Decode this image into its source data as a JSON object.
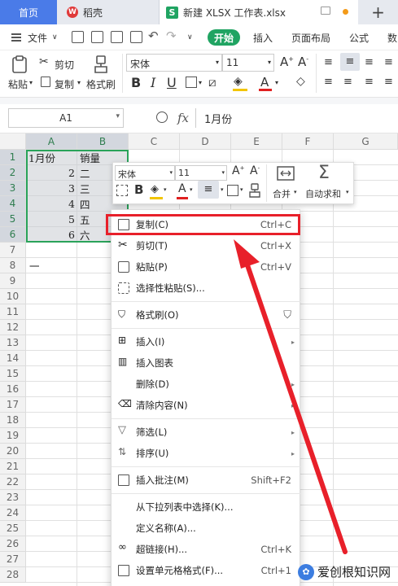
{
  "tabs": {
    "home": "首页",
    "wps": "稻壳",
    "file": "新建 XLSX 工作表.xlsx",
    "plus": "+"
  },
  "menu": {
    "file": "文件",
    "start": "开始",
    "insert": "插入",
    "page_layout": "页面布局",
    "formula": "公式",
    "data": "数"
  },
  "ribbon": {
    "paste": "粘贴",
    "cut": "剪切",
    "copy": "复制",
    "format_painter": "格式刷",
    "font_name": "宋体",
    "font_size": "11"
  },
  "formula_bar": {
    "name_box": "A1",
    "fx": "fx",
    "value": "1月份"
  },
  "grid": {
    "columns": [
      "A",
      "B",
      "C",
      "D",
      "E",
      "F",
      "G"
    ],
    "rows": [
      "1",
      "2",
      "3",
      "4",
      "5",
      "6",
      "7",
      "8",
      "9",
      "10",
      "11",
      "12",
      "13",
      "14",
      "15",
      "16",
      "17",
      "18",
      "19",
      "20",
      "21",
      "22",
      "23",
      "24",
      "25",
      "26",
      "27",
      "28"
    ],
    "cells": {
      "a1": "1月份",
      "b1": "销量",
      "a2": "2",
      "b2": "二",
      "a3": "3",
      "b3": "三",
      "a4": "4",
      "b4": "四",
      "a5": "5",
      "b5": "五",
      "a6": "6",
      "b6": "六",
      "a8": "一"
    }
  },
  "minibar": {
    "font_name": "宋体",
    "font_size": "11",
    "merge": "合并",
    "autosum": "自动求和"
  },
  "context_menu": {
    "copy": "复制(C)",
    "copy_sc": "Ctrl+C",
    "cut": "剪切(T)",
    "cut_sc": "Ctrl+X",
    "paste": "粘贴(P)",
    "paste_sc": "Ctrl+V",
    "paste_special": "选择性粘贴(S)...",
    "format_painter": "格式刷(O)",
    "insert": "插入(I)",
    "insert_chart": "插入图表",
    "delete": "删除(D)",
    "clear": "清除内容(N)",
    "filter": "筛选(L)",
    "sort": "排序(U)",
    "comment": "插入批注(M)",
    "comment_sc": "Shift+F2",
    "pick_list": "从下拉列表中选择(K)...",
    "define_name": "定义名称(A)...",
    "hyperlink": "超链接(H)...",
    "hyperlink_sc": "Ctrl+K",
    "cell_format": "设置单元格格式(F)...",
    "cell_format_sc": "Ctrl+1"
  },
  "watermark": "爱创根知识网",
  "colors": {
    "accent_green": "#20a462",
    "highlight_red": "#e8202a",
    "home_tab_blue": "#4a7be8"
  }
}
